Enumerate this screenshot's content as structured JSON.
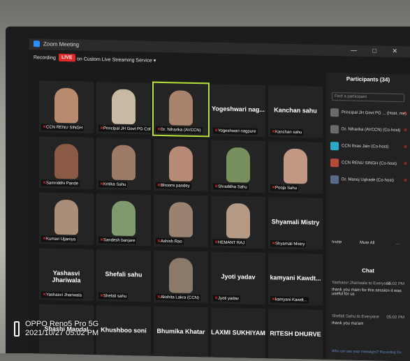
{
  "window": {
    "title": "Zoom Meeting",
    "controls": "— □ ✕"
  },
  "toolbar": {
    "recording": "Recording",
    "live": "LIVE",
    "streaming": "on Custom Live Streaming Service ▾"
  },
  "tiles": [
    {
      "name": "CCN RENU SINGH",
      "big": ""
    },
    {
      "name": "Principal JH Govt PG Colle...",
      "big": ""
    },
    {
      "name": "Dr. Niharika (AVCCN)",
      "big": "",
      "active": true
    },
    {
      "name": "Yogeshwari nagpure",
      "big": "Yogeshwari nag..."
    },
    {
      "name": "Kanchan sahu",
      "big": "Kanchan sahu"
    },
    {
      "name": "Samriddhi Pande",
      "big": ""
    },
    {
      "name": "Kritika Sahu",
      "big": ""
    },
    {
      "name": "Bhoomi pandey",
      "big": ""
    },
    {
      "name": "Shraddha Sahu",
      "big": ""
    },
    {
      "name": "Pooja Sahu",
      "big": ""
    },
    {
      "name": "Kumari Ujjaniya",
      "big": ""
    },
    {
      "name": "Sandesh banjare",
      "big": ""
    },
    {
      "name": "Ashish Rao",
      "big": ""
    },
    {
      "name": "HEMANT RAJ",
      "big": ""
    },
    {
      "name": "Shyamali Mistry",
      "big": "Shyamali Mistry"
    },
    {
      "name": "Yashasvi Jhariwala",
      "big": "Yashasvi Jhariwala"
    },
    {
      "name": "Shefali sahu",
      "big": "Shefali sahu"
    },
    {
      "name": "Akshita Lakra (CCN)",
      "big": ""
    },
    {
      "name": "Jyoti yadav",
      "big": "Jyoti yadav"
    },
    {
      "name": "kamyani Kawdt...",
      "big": "kamyani Kawdt..."
    },
    {
      "name": "",
      "big": "Shashi Mandal"
    },
    {
      "name": "",
      "big": "Khushboo soni"
    },
    {
      "name": "",
      "big": "Bhumika Khatar"
    },
    {
      "name": "",
      "big": "LAXMI SUKHIYAM"
    },
    {
      "name": "",
      "big": "RITESH DHURVE"
    }
  ],
  "panel": {
    "title": "Participants (34)",
    "find_placeholder": "Find a participant",
    "participants": [
      "Principal JH Govt PG ... (Host, me)",
      "Dr. Niharika (AVCCN) (Co-host)",
      "CCN Ihras Jain (Co-host)",
      "CCN RENU SINGH (Co-host)",
      "Dr. Manoj Ughade (Co-host)"
    ],
    "invite": "Invite",
    "mute_all": "Mute All",
    "more": "...",
    "chat_title": "Chat",
    "messages": [
      {
        "from": "Yashasvi Jhariwala to Everyone",
        "time": "05:02 PM",
        "text": "thank you mam for this session it was useful for us"
      },
      {
        "from": "Shefali Sahu to Everyone",
        "time": "05:02 PM",
        "text": "thank you ma'am"
      }
    ],
    "chat_footer": "Who can see your messages? Recording On"
  },
  "watermark": {
    "line1": "OPPO Reno5 Pro 5G",
    "line2": "2021/10/27 05:02 PM"
  }
}
